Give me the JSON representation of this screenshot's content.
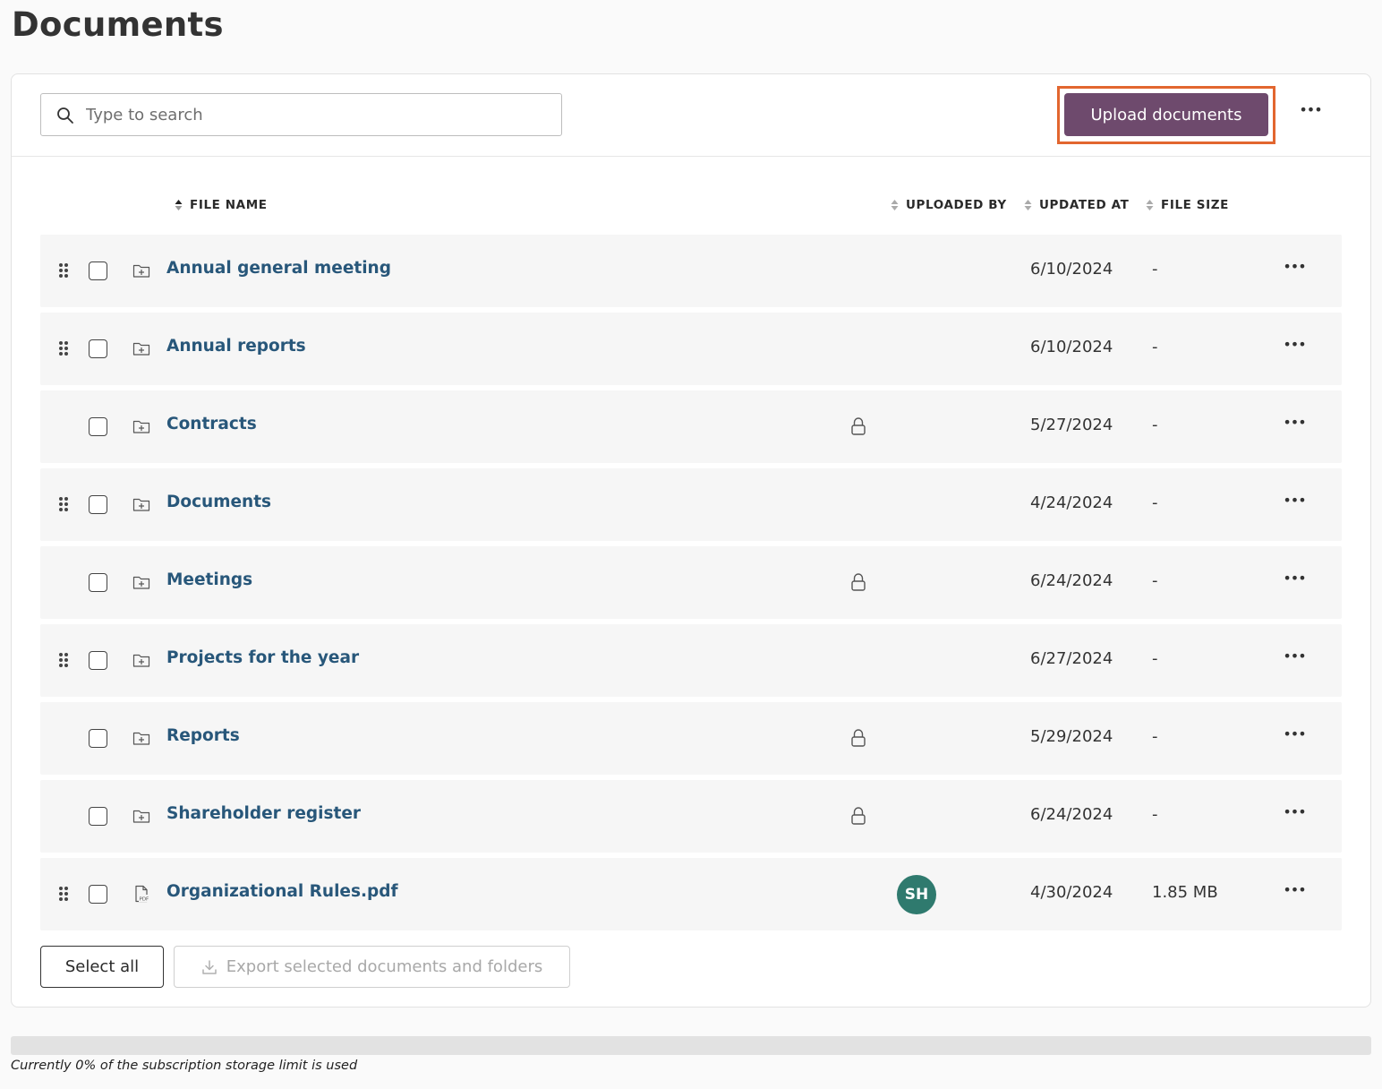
{
  "page": {
    "title": "Documents"
  },
  "toolbar": {
    "search_placeholder": "Type to search",
    "search_value": "",
    "upload_label": "Upload documents",
    "more_label": "•••"
  },
  "columns": {
    "file_name": "FILE NAME",
    "uploaded_by": "UPLOADED BY",
    "updated_at": "UPDATED AT",
    "file_size": "FILE SIZE"
  },
  "rows": [
    {
      "name": "Annual general meeting",
      "type": "folder",
      "draggable": true,
      "locked": false,
      "uploaded_by": "",
      "updated_at": "6/10/2024",
      "size": "-",
      "more": "•••"
    },
    {
      "name": "Annual reports",
      "type": "folder",
      "draggable": true,
      "locked": false,
      "uploaded_by": "",
      "updated_at": "6/10/2024",
      "size": "-",
      "more": "•••"
    },
    {
      "name": "Contracts",
      "type": "folder",
      "draggable": false,
      "locked": true,
      "uploaded_by": "",
      "updated_at": "5/27/2024",
      "size": "-",
      "more": "•••"
    },
    {
      "name": "Documents",
      "type": "folder",
      "draggable": true,
      "locked": false,
      "uploaded_by": "",
      "updated_at": "4/24/2024",
      "size": "-",
      "more": "•••"
    },
    {
      "name": "Meetings",
      "type": "folder",
      "draggable": false,
      "locked": true,
      "uploaded_by": "",
      "updated_at": "6/24/2024",
      "size": "-",
      "more": "•••"
    },
    {
      "name": "Projects for the year",
      "type": "folder",
      "draggable": true,
      "locked": false,
      "uploaded_by": "",
      "updated_at": "6/27/2024",
      "size": "-",
      "more": "•••"
    },
    {
      "name": "Reports",
      "type": "folder",
      "draggable": false,
      "locked": true,
      "uploaded_by": "",
      "updated_at": "5/29/2024",
      "size": "-",
      "more": "•••"
    },
    {
      "name": "Shareholder register",
      "type": "folder",
      "draggable": false,
      "locked": true,
      "uploaded_by": "",
      "updated_at": "6/24/2024",
      "size": "-",
      "more": "•••"
    },
    {
      "name": "Organizational Rules.pdf",
      "type": "pdf",
      "draggable": true,
      "locked": false,
      "uploaded_by": "SH",
      "updated_at": "4/30/2024",
      "size": "1.85 MB",
      "more": "•••"
    }
  ],
  "footer": {
    "select_all_label": "Select all",
    "export_label": "Export selected documents and folders"
  },
  "storage": {
    "used_fraction": 0,
    "text": "Currently 0% of the subscription storage limit is used"
  },
  "colors": {
    "accent": "#6e4a6d",
    "highlight": "#e2662f",
    "link": "#28577a",
    "avatar": "#2f7a6e"
  }
}
